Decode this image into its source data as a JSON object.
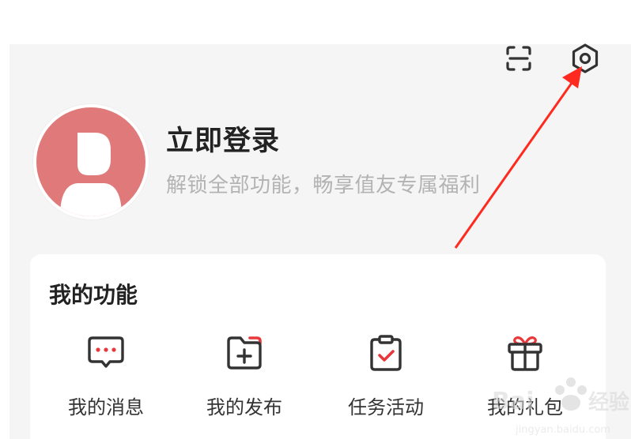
{
  "header": {
    "scan_icon": "scan-icon",
    "settings_icon": "settings-icon"
  },
  "profile": {
    "title": "立即登录",
    "subtitle": "解锁全部功能，畅享值友专属福利"
  },
  "functions": {
    "title": "我的功能",
    "items": [
      {
        "label": "我的消息",
        "icon": "message-icon"
      },
      {
        "label": "我的发布",
        "icon": "publish-folder-icon"
      },
      {
        "label": "任务活动",
        "icon": "task-clipboard-icon"
      },
      {
        "label": "我的礼包",
        "icon": "gift-icon"
      }
    ]
  },
  "colors": {
    "accent": "#e8383b",
    "avatar": "#e07a7a",
    "icon": "#333333",
    "annotation": "#ff2a1f"
  }
}
